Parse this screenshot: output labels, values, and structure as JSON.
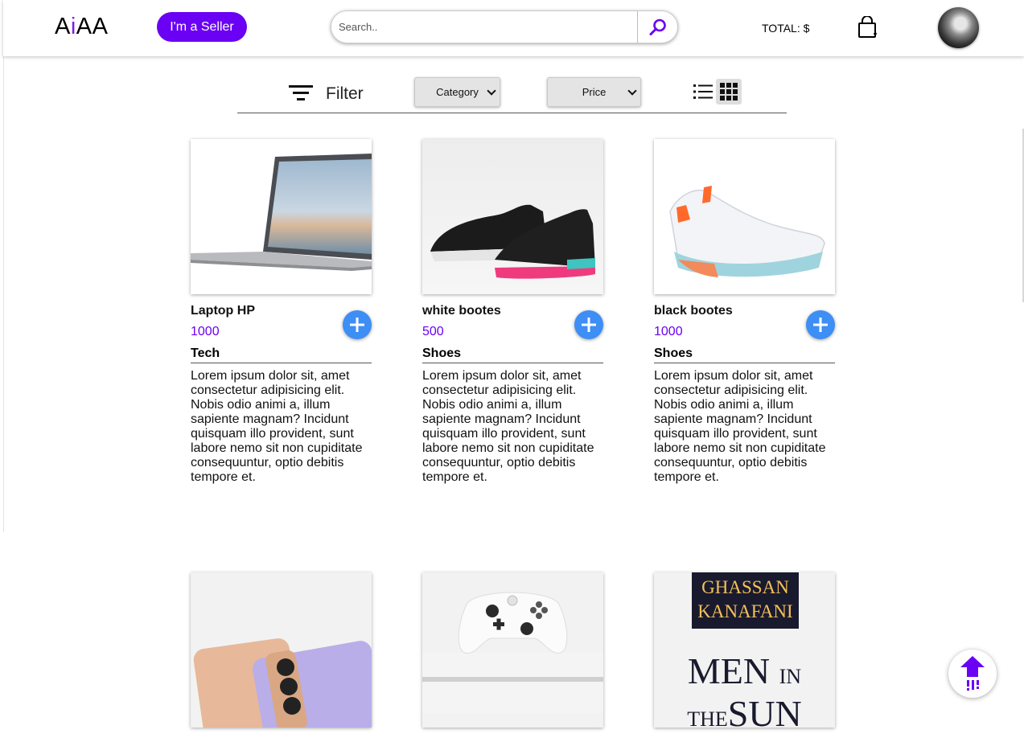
{
  "header": {
    "logo_a": "A",
    "logo_i": "i",
    "logo_rest": "AA",
    "seller_label": "I'm a Seller",
    "search_placeholder": "Search..",
    "total_label": "TOTAL: $"
  },
  "filter": {
    "label": "Filter",
    "category_select": "Category",
    "price_select": "Price"
  },
  "products": [
    {
      "name": "Laptop HP",
      "price": "1000",
      "category": "Tech",
      "description": "Lorem ipsum dolor sit, amet consectetur adipisicing elit. Nobis odio animi a, illum sapiente magnam? Incidunt quisquam illo provident, sunt labore nemo sit non cupiditate consequuntur, optio debitis tempore et."
    },
    {
      "name": "white bootes",
      "price": "500",
      "category": "Shoes",
      "description": "Lorem ipsum dolor sit, amet consectetur adipisicing elit. Nobis odio animi a, illum sapiente magnam? Incidunt quisquam illo provident, sunt labore nemo sit non cupiditate consequuntur, optio debitis tempore et."
    },
    {
      "name": "black bootes",
      "price": "1000",
      "category": "Shoes",
      "description": "Lorem ipsum dolor sit, amet consectetur adipisicing elit. Nobis odio animi a, illum sapiente magnam? Incidunt quisquam illo provident, sunt labore nemo sit non cupiditate consequuntur, optio debitis tempore et."
    }
  ],
  "book_cover": {
    "author_line1": "GHASSAN",
    "author_line2": "KANAFANI",
    "title_line1": "MEN",
    "title_small1": "IN",
    "title_small2": "THE",
    "title_line2": "SUN"
  },
  "icons": {
    "search": "magnifier-icon",
    "cart": "shopping-bag-icon",
    "filter": "filter-lines-icon",
    "list": "list-view-icon",
    "grid": "grid-view-icon",
    "add": "plus-icon",
    "scroll": "arrow-up-icon"
  },
  "colors": {
    "accent": "#6a00f4",
    "add_button": "#3d8ef5"
  }
}
